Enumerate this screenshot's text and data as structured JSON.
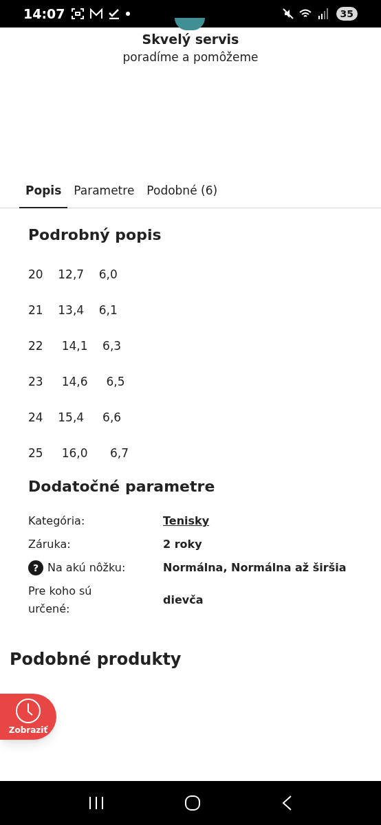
{
  "status_bar": {
    "time": "14:07",
    "battery": "35"
  },
  "service": {
    "title": "Skvelý servis",
    "subtitle": "poradíme a pomôžeme"
  },
  "tabs": [
    {
      "label": "Popis",
      "selected": true
    },
    {
      "label": "Parametre",
      "selected": false
    },
    {
      "label": "Podobné (6)",
      "selected": false
    }
  ],
  "description": {
    "title": "Podrobný popis",
    "lines": [
      "20    12,7    6,0",
      "21    13,4    6,1",
      "22     14,1    6,3",
      "23     14,6     6,5",
      "24    15,4     6,6",
      "25     16,0      6,7"
    ]
  },
  "parameters": {
    "title": "Dodatočné parametre",
    "rows": [
      {
        "label": "Kategória:",
        "value": "Tenisky",
        "kind": "link"
      },
      {
        "label": "Záruka:",
        "value": "2 roky",
        "kind": "text"
      },
      {
        "label": "Na akú nôžku:",
        "value": "Normálna, Normálna až širšia",
        "kind": "text",
        "help_icon": "?"
      },
      {
        "label": "Pre koho sú určené:",
        "value": "dievča",
        "kind": "text"
      }
    ]
  },
  "similar": {
    "title": "Podobné produkty"
  },
  "floating_button": {
    "label": "Zobraziť"
  }
}
